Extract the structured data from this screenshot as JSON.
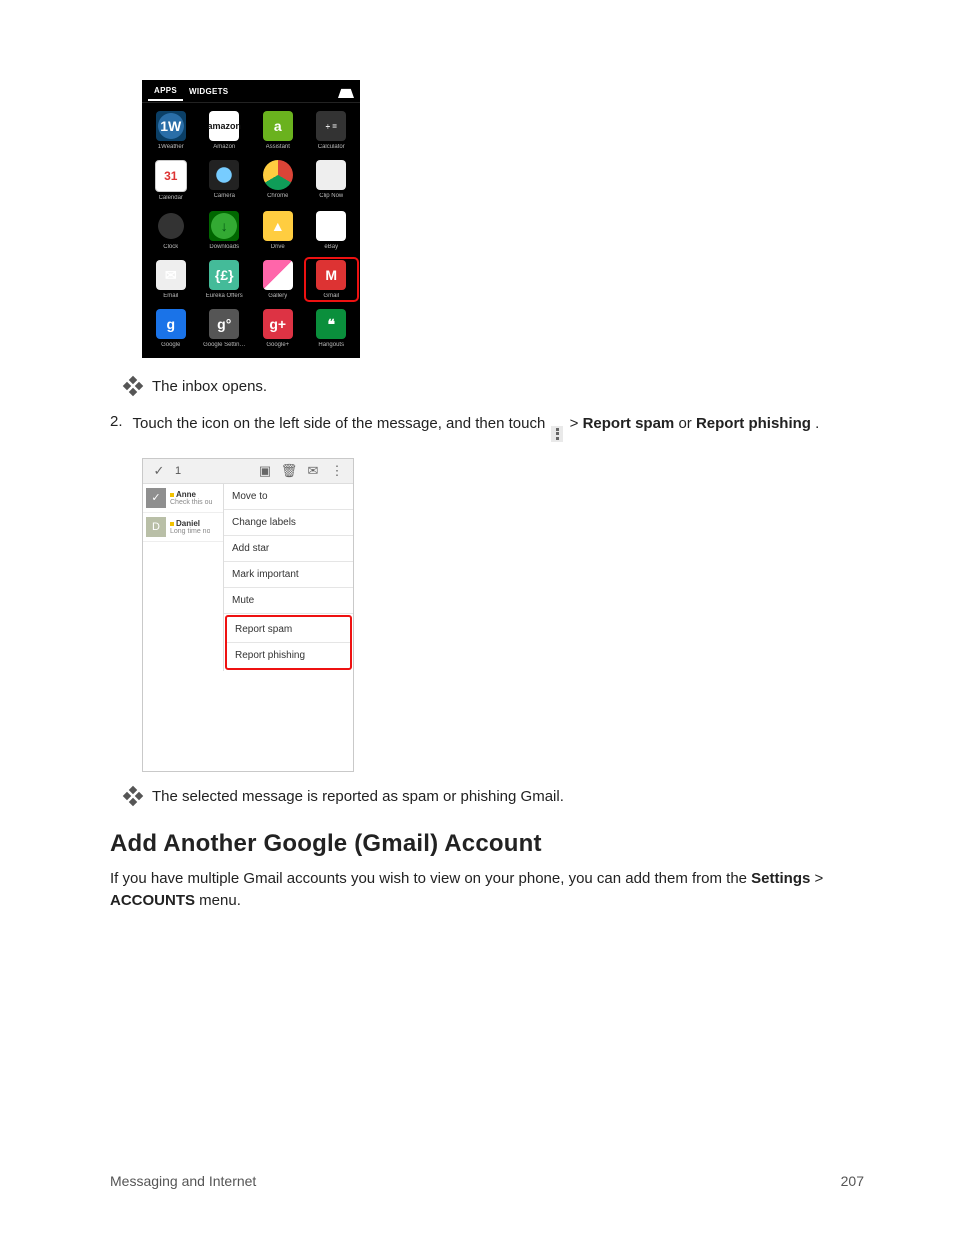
{
  "screenshot1": {
    "tabs": {
      "apps": "APPS",
      "widgets": "WIDGETS"
    },
    "apps": [
      {
        "label": "1Weather",
        "glyph": "1W",
        "cls": "ic-1w"
      },
      {
        "label": "Amazon",
        "glyph": "amazon",
        "cls": "ic-amz"
      },
      {
        "label": "Assistant",
        "glyph": "a",
        "cls": "ic-ass"
      },
      {
        "label": "Calculator",
        "glyph": "÷ =",
        "cls": "ic-calc"
      },
      {
        "label": "Calendar",
        "glyph": "31",
        "cls": "ic-cal"
      },
      {
        "label": "Camera",
        "glyph": "",
        "cls": "ic-cam"
      },
      {
        "label": "Chrome",
        "glyph": "",
        "cls": "ic-chr"
      },
      {
        "label": "Clip Now",
        "glyph": "",
        "cls": "ic-clip"
      },
      {
        "label": "Clock",
        "glyph": "",
        "cls": "ic-clock"
      },
      {
        "label": "Downloads",
        "glyph": "↓",
        "cls": "ic-dl"
      },
      {
        "label": "Drive",
        "glyph": "▲",
        "cls": "ic-drv"
      },
      {
        "label": "eBay",
        "glyph": "ebay",
        "cls": "ic-ebay"
      },
      {
        "label": "Email",
        "glyph": "✉",
        "cls": "ic-email"
      },
      {
        "label": "Eureka Offers",
        "glyph": "{£}",
        "cls": "ic-eur"
      },
      {
        "label": "Gallery",
        "glyph": "",
        "cls": "ic-gal"
      },
      {
        "label": "Gmail",
        "glyph": "M",
        "cls": "ic-gmail",
        "highlight": true
      },
      {
        "label": "Google",
        "glyph": "g",
        "cls": "ic-goog"
      },
      {
        "label": "Google Settin…",
        "glyph": "g°",
        "cls": "ic-gset"
      },
      {
        "label": "Google+",
        "glyph": "g+",
        "cls": "ic-gplus"
      },
      {
        "label": "Hangouts",
        "glyph": "❝",
        "cls": "ic-hang"
      }
    ]
  },
  "note1": "The inbox opens.",
  "step2": {
    "number": "2.",
    "pre": "Touch the icon on the left side of the message, and then touch ",
    "post_gt": " > ",
    "bold1": "Report spam",
    "or": " or ",
    "bold2": "Report phishing",
    "period": "."
  },
  "screenshot2": {
    "selected_count": "1",
    "messages": [
      {
        "name": "Anne",
        "snippet": "Check this ou",
        "avatar": "✓",
        "sel": true
      },
      {
        "name": "Daniel",
        "snippet": "Long time no",
        "avatar": "D",
        "sel": false
      }
    ],
    "menu": [
      "Move to",
      "Change labels",
      "Add star",
      "Mark important",
      "Mute"
    ],
    "menu_highlight": [
      "Report spam",
      "Report phishing"
    ]
  },
  "note2": "The selected message is reported as spam or phishing Gmail.",
  "heading": "Add Another Google (Gmail) Account",
  "paragraph": {
    "pre": "If you have multiple Gmail accounts you wish to view on your phone, you can add them from the ",
    "b1": "Settings",
    "mid": " > ",
    "b2": "ACCOUNTS",
    "post": " menu."
  },
  "footer": {
    "section": "Messaging and Internet",
    "page": "207"
  }
}
